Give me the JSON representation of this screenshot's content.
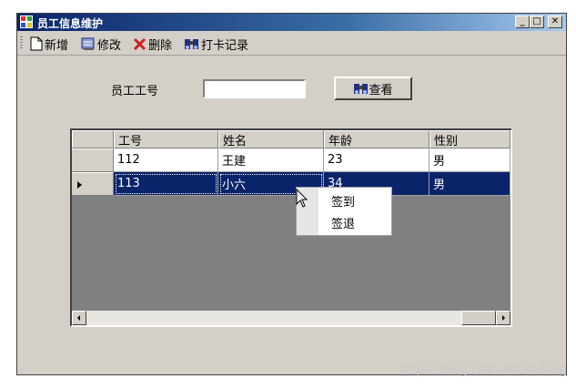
{
  "window": {
    "title": "员工信息维护",
    "minimize": "_",
    "maximize": "□",
    "close": "✕"
  },
  "toolbar": {
    "items": [
      {
        "label": "新增",
        "icon": "new-document-icon"
      },
      {
        "label": "修改",
        "icon": "edit-icon"
      },
      {
        "label": "删除",
        "icon": "delete-icon"
      },
      {
        "label": "打卡记录",
        "icon": "binoculars-icon"
      }
    ]
  },
  "search": {
    "label": "员工工号",
    "value": "",
    "button_label": "查看",
    "button_icon": "binoculars-icon"
  },
  "grid": {
    "columns": [
      "工号",
      "姓名",
      "年龄",
      "性别"
    ],
    "rows": [
      {
        "id": "112",
        "name": "王建",
        "age": "23",
        "gender": "男",
        "selected": false
      },
      {
        "id": "113",
        "name": "小六",
        "age": "34",
        "gender": "男",
        "selected": true
      }
    ]
  },
  "context_menu": {
    "items": [
      "签到",
      "签退"
    ]
  },
  "watermark": "https://blog.csdn.net/ifubing",
  "colors": {
    "title_bar": "#0a246a",
    "selection": "#0a246a",
    "face": "#d4d0c8",
    "grid_empty": "#808080"
  }
}
